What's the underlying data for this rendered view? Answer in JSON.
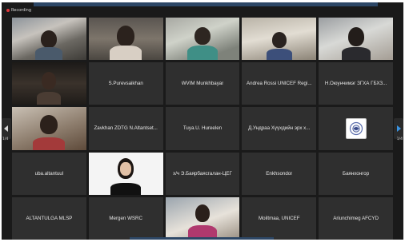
{
  "recording": {
    "label": "Recording"
  },
  "navigation": {
    "page_left": "1/4",
    "page_right": "1/4"
  },
  "participants": [
    {
      "name": ""
    },
    {
      "name": ""
    },
    {
      "name": ""
    },
    {
      "name": ""
    },
    {
      "name": ""
    },
    {
      "name": ""
    },
    {
      "name": "S.Purevsaikhan"
    },
    {
      "name": "WVIM Munkhbayar"
    },
    {
      "name": "Andrea Rossi UNICEF Regi..."
    },
    {
      "name": "Н.Оюунчимэг ЗГХА ГБХЗ..."
    },
    {
      "name": ""
    },
    {
      "name": "Zavkhan ZDTG N.Altantset..."
    },
    {
      "name": "Tuya.U. Hureelen"
    },
    {
      "name": "Д.Ундраа Хүүхдийн эрх х..."
    },
    {
      "name": ""
    },
    {
      "name": "uba.altantuul"
    },
    {
      "name": ""
    },
    {
      "name": "х/ч Э.Баярбаясгалан-ЦЕГ"
    },
    {
      "name": "Enkhsondor"
    },
    {
      "name": "Баянхонгор"
    },
    {
      "name": "ALTANTULGA MLSP"
    },
    {
      "name": "Mergen WSRC"
    },
    {
      "name": ""
    },
    {
      "name": "Moiltmaa, UNICEF"
    },
    {
      "name": "Ariunchimeg AFCYD"
    }
  ],
  "colors": {
    "speaking_border": "#d6cd3f",
    "recording_dot": "#e0363a",
    "nav_arrow": "#3a93e0",
    "tile_bg": "#2f2f2f"
  }
}
